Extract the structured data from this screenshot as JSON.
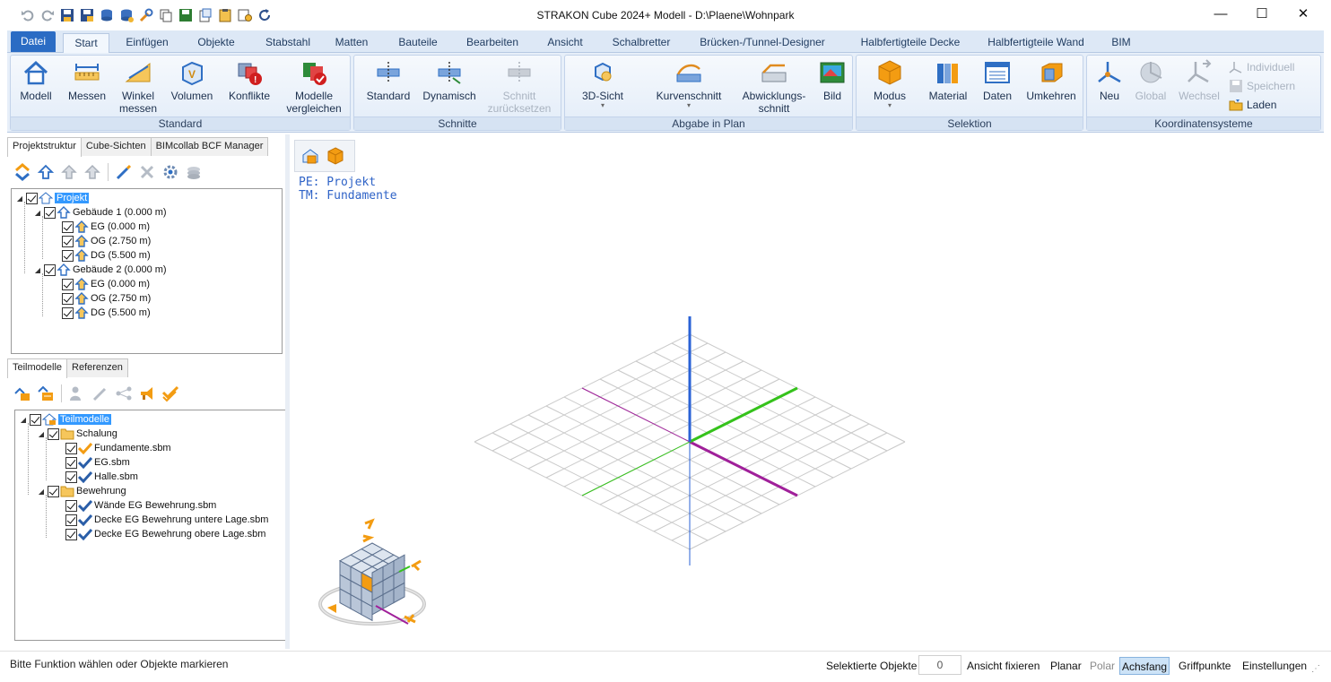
{
  "window": {
    "title": "STRAKON Cube 2024+ Modell - D:\\Plaene\\Wohnpark",
    "minimize": "—",
    "maximize": "☐",
    "close": "✕"
  },
  "quick_access": [
    "undo-icon",
    "redo-icon",
    "save-icon",
    "save-as-icon",
    "database-icon",
    "database-import-icon",
    "tools-icon",
    "copy-icon",
    "disk-icon",
    "paste-icon",
    "clipboard-icon",
    "settings-icon",
    "refresh-icon"
  ],
  "tabs": [
    {
      "label": "Datei",
      "kind": "file"
    },
    {
      "label": "Start",
      "kind": "active"
    },
    {
      "label": "Einfügen"
    },
    {
      "label": "Objekte"
    },
    {
      "label": "Stabstahl"
    },
    {
      "label": "Matten"
    },
    {
      "label": "Bauteile"
    },
    {
      "label": "Bearbeiten"
    },
    {
      "label": "Ansicht"
    },
    {
      "label": "Schalbretter"
    },
    {
      "label": "Brücken-/Tunnel-Designer"
    },
    {
      "label": "Halbfertigteile Decke"
    },
    {
      "label": "Halbfertigteile Wand"
    },
    {
      "label": "BIM"
    }
  ],
  "ribbon": {
    "groups": {
      "standard": "Standard",
      "schnitte": "Schnitte",
      "abgabe": "Abgabe in Plan",
      "selektion": "Selektion",
      "koordinaten": "Koordinatensysteme"
    },
    "buttons": {
      "modell": "Modell",
      "messen": "Messen",
      "winkel_1": "Winkel",
      "winkel_2": "messen",
      "volumen": "Volumen",
      "konflikte": "Konflikte",
      "vergleich_1": "Modelle",
      "vergleich_2": "vergleichen",
      "standard": "Standard",
      "dynamisch": "Dynamisch",
      "schnitt_1": "Schnitt",
      "schnitt_2": "zurücksetzen",
      "sicht": "3D-Sicht",
      "kurvenschnitt": "Kurvenschnitt",
      "abw_1": "Abwicklungs-",
      "abw_2": "schnitt",
      "bild": "Bild",
      "modus": "Modus",
      "material": "Material",
      "daten": "Daten",
      "umkehren": "Umkehren",
      "neu": "Neu",
      "global": "Global",
      "wechsel": "Wechsel",
      "individuell": "Individuell",
      "speichern": "Speichern",
      "laden": "Laden"
    }
  },
  "left_panel": {
    "top_tabs": [
      "Projektstruktur",
      "Cube-Sichten",
      "BIMcollab BCF Manager"
    ],
    "project_tree": [
      {
        "label": "Projekt",
        "level": 0,
        "selected": true
      },
      {
        "label": "Gebäude 1 (0.000 m)",
        "level": 1
      },
      {
        "label": "EG (0.000 m)",
        "level": 2
      },
      {
        "label": "OG (2.750 m)",
        "level": 2
      },
      {
        "label": "DG (5.500 m)",
        "level": 2
      },
      {
        "label": "Gebäude 2 (0.000 m)",
        "level": 1
      },
      {
        "label": "EG (0.000 m)",
        "level": 2
      },
      {
        "label": "OG (2.750 m)",
        "level": 2
      },
      {
        "label": "DG (5.500 m)",
        "level": 2
      }
    ],
    "bottom_tabs": [
      "Teilmodelle",
      "Referenzen"
    ],
    "submodel_tree": [
      {
        "label": "Teilmodelle",
        "level": 0,
        "selected": true,
        "icon": "folder"
      },
      {
        "label": "Schalung",
        "level": 1,
        "icon": "folder"
      },
      {
        "label": "Fundamente.sbm",
        "level": 2,
        "icon": "orange-check"
      },
      {
        "label": "EG.sbm",
        "level": 2,
        "icon": "blue-check"
      },
      {
        "label": "Halle.sbm",
        "level": 2,
        "icon": "blue-check"
      },
      {
        "label": "Bewehrung",
        "level": 1,
        "icon": "folder"
      },
      {
        "label": "Wände EG Bewehrung.sbm",
        "level": 2,
        "icon": "blue-check"
      },
      {
        "label": "Decke EG Bewehrung untere Lage.sbm",
        "level": 2,
        "icon": "blue-check"
      },
      {
        "label": "Decke EG Bewehrung obere Lage.sbm",
        "level": 2,
        "icon": "blue-check"
      }
    ]
  },
  "viewport": {
    "pe": "PE: Projekt",
    "tm": "TM: Fundamente"
  },
  "status": {
    "message": "Bitte Funktion wählen oder Objekte markieren",
    "selected_label": "Selektierte Objekte",
    "selected_count": "0",
    "ansicht": "Ansicht fixieren",
    "planar": "Planar",
    "polar": "Polar",
    "achsfang": "Achsfang",
    "griffpunkte": "Griffpunkte",
    "einstellungen": "Einstellungen"
  },
  "colors": {
    "accent": "#2b6cc4",
    "axis_z": "#2a62d6",
    "axis_green": "#35c21b",
    "axis_magenta": "#a0209a",
    "grid": "#c8c8c8",
    "orange": "#f39c12"
  }
}
